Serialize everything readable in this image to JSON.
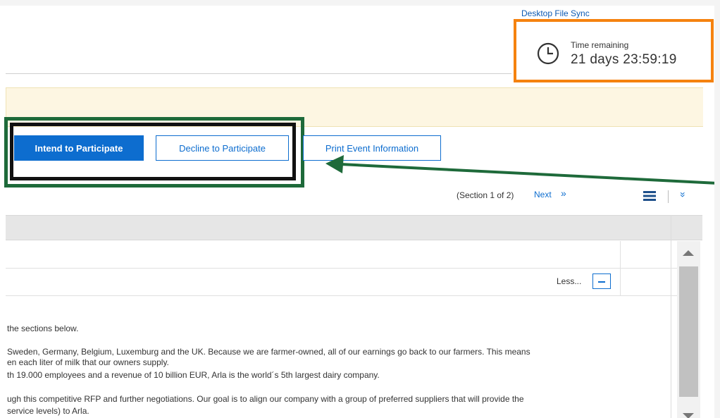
{
  "header": {
    "sync_link": "Desktop File Sync",
    "timer_label": "Time remaining",
    "timer_value": "21 days 23:59:19"
  },
  "actions": {
    "intend": "Intend to Participate",
    "decline": "Decline to Participate",
    "print": "Print Event Information"
  },
  "pagination": {
    "section_info": "(Section 1 of 2)",
    "next_label": "Next",
    "next_icon": "»",
    "collapse_icon": "»"
  },
  "table": {
    "less_label": "Less..."
  },
  "description": {
    "lines": [
      "the sections below.",
      "Sweden, Germany, Belgium, Luxemburg and the UK. Because we are farmer-owned, all of our earnings go back to our farmers. This means",
      "en each liter of milk that our owners supply.",
      "th 19.000 employees and a revenue of 10 billion EUR, Arla is the world´s 5th largest dairy company.",
      "ugh this competitive RFP and further negotiations. Our goal is to align our company with a group of preferred suppliers that will provide the",
      "service levels) to Arla."
    ]
  },
  "colors": {
    "primary": "#0d6dcf",
    "timer_highlight": "#f5820f",
    "annotation_green": "#1e6a3a",
    "notice_bg": "#fdf6e2"
  },
  "icons": {
    "clock": "clock-icon",
    "list": "list-view-icon",
    "minus": "minus-icon"
  }
}
